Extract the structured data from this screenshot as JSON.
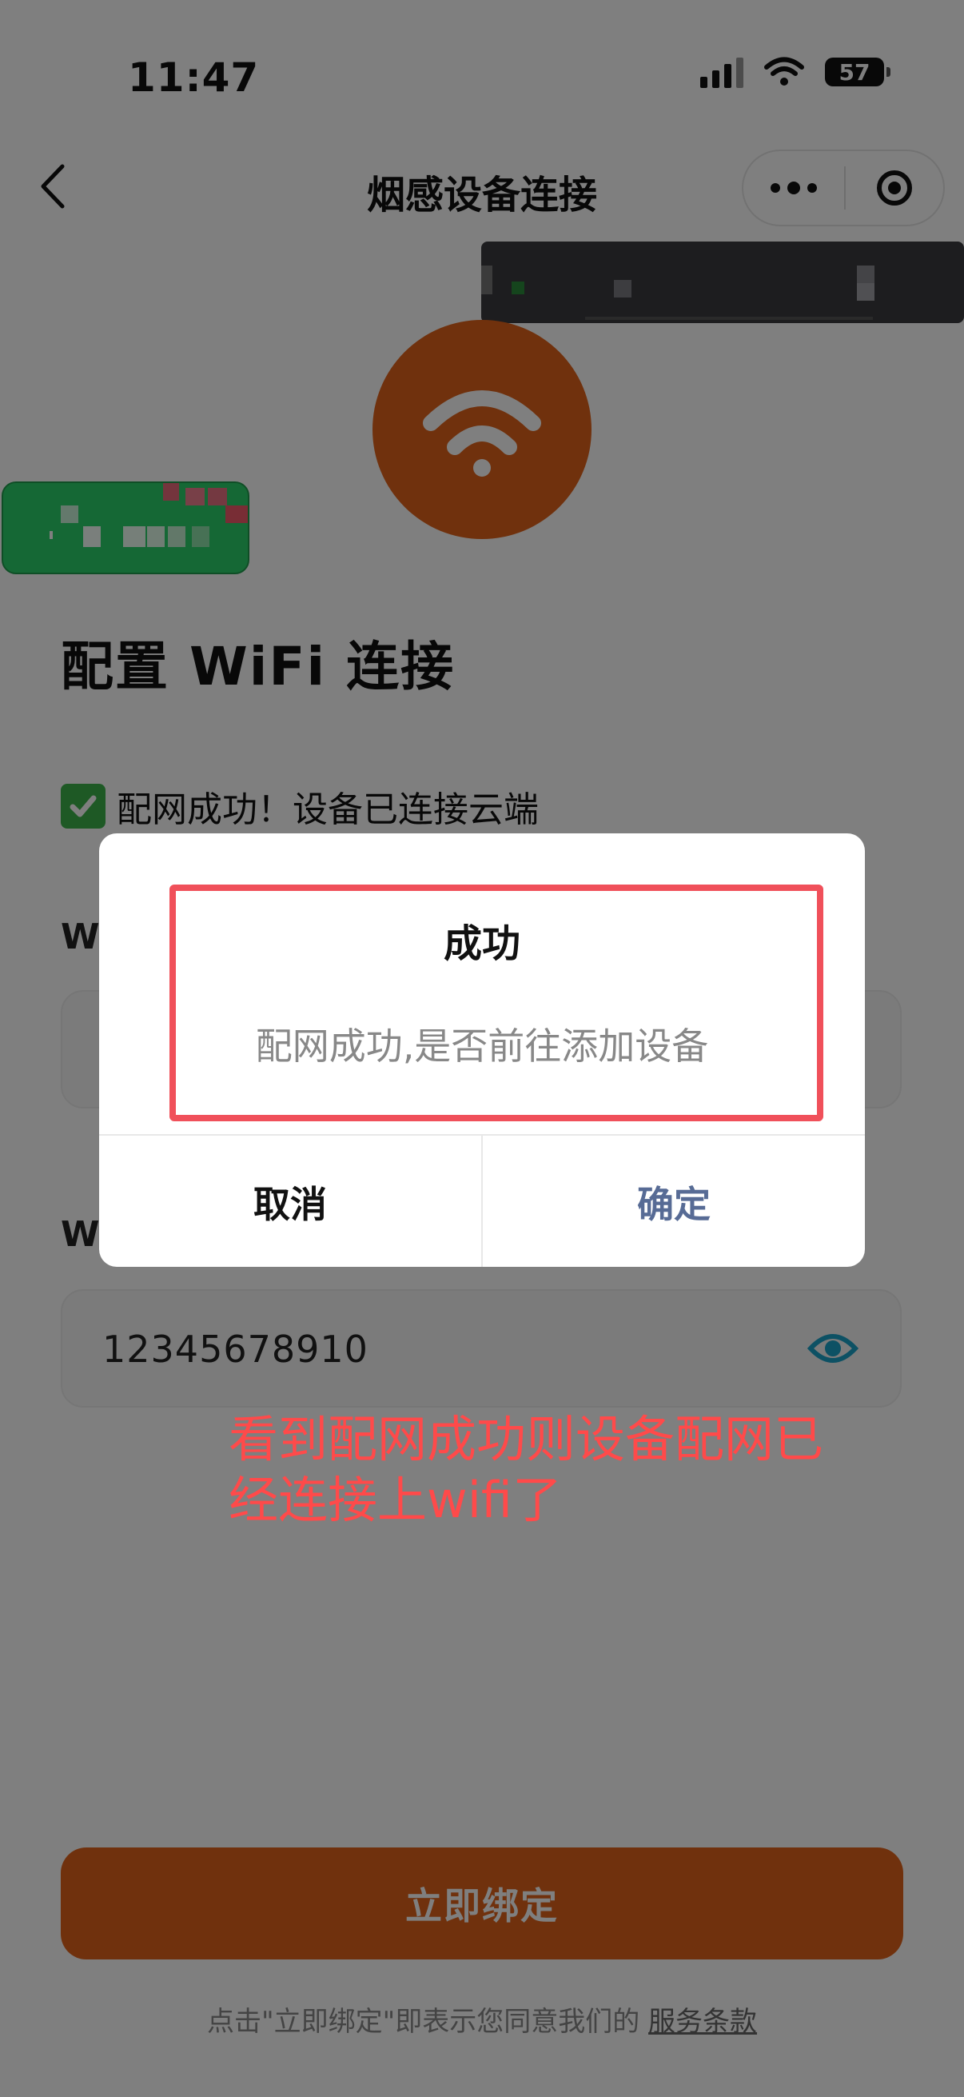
{
  "status_bar": {
    "time": "11:47",
    "battery": "57"
  },
  "nav": {
    "title": "烟感设备连接"
  },
  "page": {
    "heading": "配置 WiFi 连接",
    "status_message": "配网成功！设备已连接云端",
    "wifi_name_label": "Wi",
    "wifi_password_label": "Wi",
    "password_value": "12345678910",
    "bind_button": "立即绑定",
    "terms_prefix": "点击\"立即绑定\"即表示您同意我们的",
    "terms_link": "服务条款"
  },
  "dialog": {
    "title": "成功",
    "content": "配网成功,是否前往添加设备",
    "cancel": "取消",
    "confirm": "确定"
  },
  "annotation": {
    "text": "看到配网成功则设备配网已经连接上wifi了"
  },
  "colors": {
    "brand_orange": "#e0631b",
    "confirm_blue": "#576b95",
    "annotation_red": "#ff4a4a",
    "success_green": "#3cb34a"
  },
  "icons": {
    "back": "chevron-left-icon",
    "more": "more-dots-icon",
    "close": "target-close-icon",
    "wifi": "wifi-icon",
    "check": "check-box-icon",
    "eye": "eye-icon"
  }
}
